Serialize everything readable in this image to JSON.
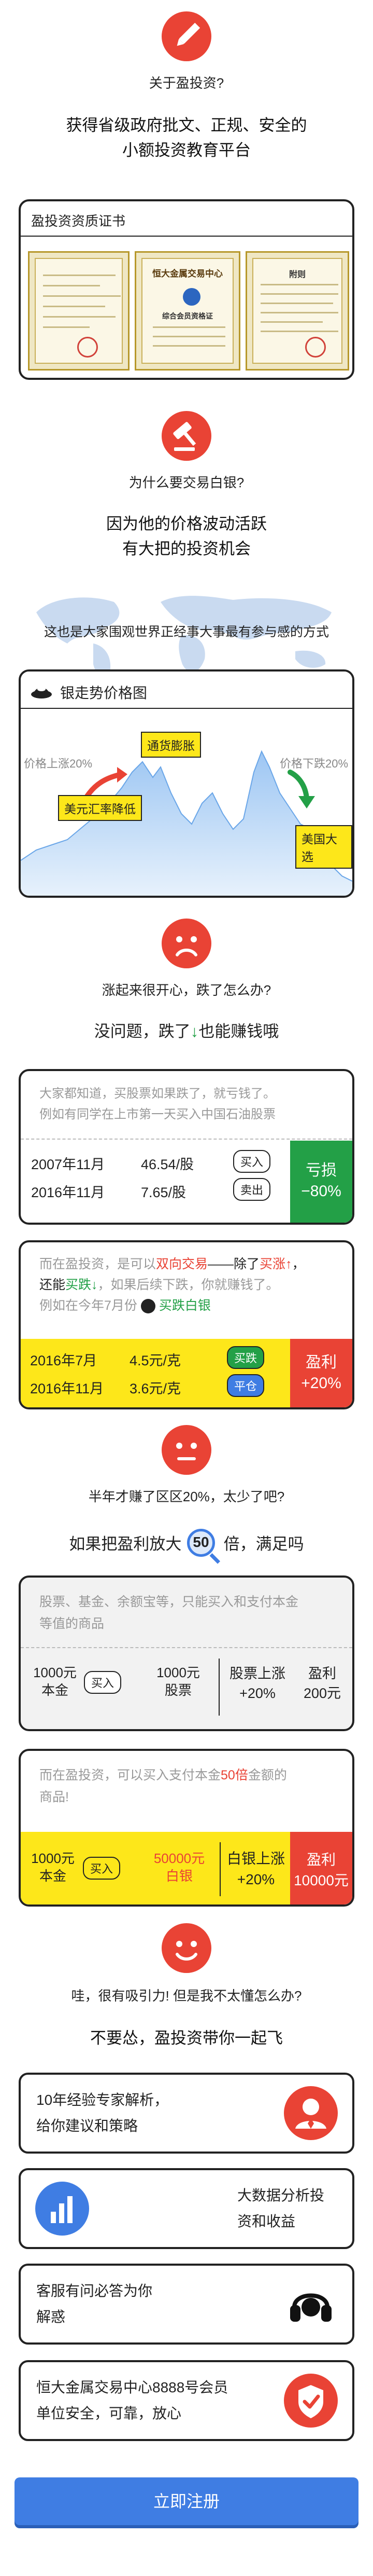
{
  "section1": {
    "icon": "pencil-icon",
    "question": "关于盈投资?",
    "headline_line1": "获得省级政府批文、正规、安全的",
    "headline_line2": "小额投资教育平台"
  },
  "certificate_card": {
    "title": "盈投资资质证书",
    "cert_center_title": "恒大金属交易中心",
    "cert_center_subtitle": "综合会员资格证",
    "cert_right_title": "附则"
  },
  "section2": {
    "icon": "gavel-icon",
    "question": "为什么要交易白银?",
    "headline_line1": "因为他的价格波动活跃",
    "headline_line2": "有大把的投资机会",
    "caption": "这也是大家围观世界正经事大事最有参与感的方式"
  },
  "trend_card": {
    "title": "银走势价格图",
    "label_left_up": "价格上涨20%",
    "label_right_down": "价格下跌20%",
    "tag_inflation": "通货膨胀",
    "tag_usd": "美元汇率降低",
    "tag_election": "美国大选"
  },
  "section3": {
    "icon": "sad-face-icon",
    "question": "涨起来很开心，跌了怎么办?",
    "answer_prefix": "没问题，跌了",
    "answer_suffix": "也能赚钱哦"
  },
  "stock_card": {
    "text_line1": "大家都知道，买股票如果跌了，就亏钱了。",
    "text_line2": "例如有同学在上市第一天买入中国石油股票",
    "row1_date": "2007年11月",
    "row1_price": "46.54/股",
    "row1_action": "买入",
    "row2_date": "2016年11月",
    "row2_price": "7.65/股",
    "row2_action": "卖出",
    "result_label": "亏损",
    "result_value": "−80%"
  },
  "silver_card": {
    "text_line1_a": "而在盈投资，是可以",
    "text_line1_b": "双向交易",
    "text_line1_c": "——除了",
    "text_line1_d": "买涨",
    "text_line2_a": "还能",
    "text_line2_b": "买跌",
    "text_line2_c": "，如果后续下跌，你就赚钱了。",
    "text_line3_a": "例如在今年7月份",
    "text_line3_b": "买跌白银",
    "row1_date": "2016年7月",
    "row1_price": "4.5元/克",
    "row1_action": "买跌",
    "row2_date": "2016年11月",
    "row2_price": "3.6元/克",
    "row2_action": "平仓",
    "result_label": "盈利",
    "result_value": "+20%"
  },
  "section4": {
    "icon": "neutral-face-icon",
    "question": "半年才赚了区区20%，太少了吧?",
    "answer_prefix": "如果把盈利放大",
    "answer_number": "50",
    "answer_suffix": "倍，满足吗"
  },
  "stock_compare_card": {
    "text_line1": "股票、基金、余额宝等，只能买入和支付本金",
    "text_line2": "等值的商品",
    "cell_capital_line1": "1000元",
    "cell_capital_line2": "本金",
    "cell_action": "买入",
    "cell_asset_line1": "1000元",
    "cell_asset_line2": "股票",
    "cell_rise_line1": "股票上涨",
    "cell_rise_line2": "+20%",
    "cell_profit_line1": "盈利",
    "cell_profit_line2": "200元"
  },
  "leverage_card": {
    "text_line1_a": "而在盈投资，可以买入支付本金",
    "text_line1_b": "50倍",
    "text_line1_c": "金额的",
    "text_line2": "商品!",
    "cell_capital_line1": "1000元",
    "cell_capital_line2": "本金",
    "cell_action": "买入",
    "cell_asset_line1": "50000元",
    "cell_asset_line2": "白银",
    "cell_rise_line1": "白银上涨",
    "cell_rise_line2": "+20%",
    "cell_profit_line1": "盈利",
    "cell_profit_line2": "10000元"
  },
  "section5": {
    "icon": "happy-face-icon",
    "question": "哇，很有吸引力! 但是我不太懂怎么办?",
    "answer": "不要怂，盈投资带你一起飞"
  },
  "features": [
    {
      "line1": "10年经验专家解析，",
      "line2": "给你建议和策略",
      "icon": "expert-avatar-icon"
    },
    {
      "line1": "大数据分析投",
      "line2": "资和收益",
      "icon": "bar-chart-icon"
    },
    {
      "line1": "客服有问必答为你",
      "line2": "解惑",
      "icon": "headset-icon"
    },
    {
      "line1": "恒大金属交易中心8888号会员",
      "line2": "单位安全，可靠，放心",
      "icon": "shield-check-icon"
    }
  ],
  "register_button": "立即注册",
  "colors": {
    "accent_red": "#e94335",
    "accent_green": "#23a047",
    "accent_yellow": "#fde71a",
    "accent_blue": "#3f7de3"
  }
}
